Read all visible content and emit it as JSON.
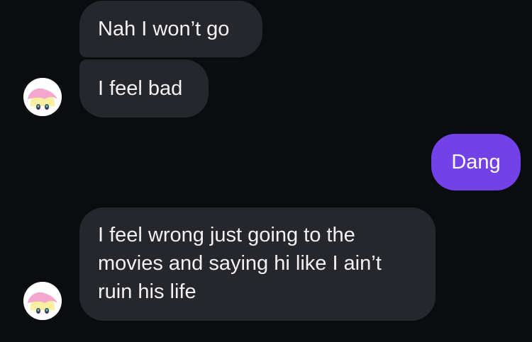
{
  "messages": [
    {
      "sender": "other",
      "text": "Nah I won’t go"
    },
    {
      "sender": "other",
      "text": "I feel bad"
    },
    {
      "sender": "me",
      "text": "Dang"
    },
    {
      "sender": "other",
      "lines": [
        "I feel wrong just going to the",
        "movies and saying hi like I ain’t",
        "ruin his life"
      ]
    }
  ],
  "avatar": {
    "icon": "pony-avatar-icon",
    "mane_color": "#f3a7cf",
    "body_color": "#f8f0a0"
  },
  "colors": {
    "background": "#0b0c10",
    "incoming_bubble": "#26272c",
    "outgoing_bubble": "#7242e8"
  }
}
